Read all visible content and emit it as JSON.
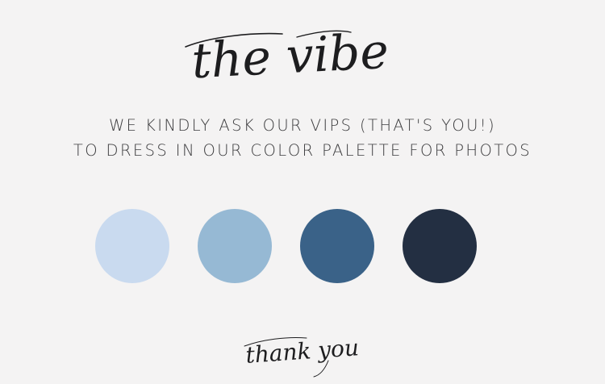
{
  "title": "the vibe",
  "message": {
    "line1": "WE KINDLY ASK OUR VIPS (THAT'S YOU!)",
    "line2": "TO DRESS IN OUR COLOR PALETTE FOR PHOTOS"
  },
  "palette": [
    {
      "name": "light-sky-blue",
      "color": "#c9daef"
    },
    {
      "name": "dusty-blue",
      "color": "#96b9d4"
    },
    {
      "name": "denim-blue",
      "color": "#3a6288"
    },
    {
      "name": "navy",
      "color": "#232f42"
    }
  ],
  "signoff": "thank you",
  "background_color": "#f4f3f3"
}
